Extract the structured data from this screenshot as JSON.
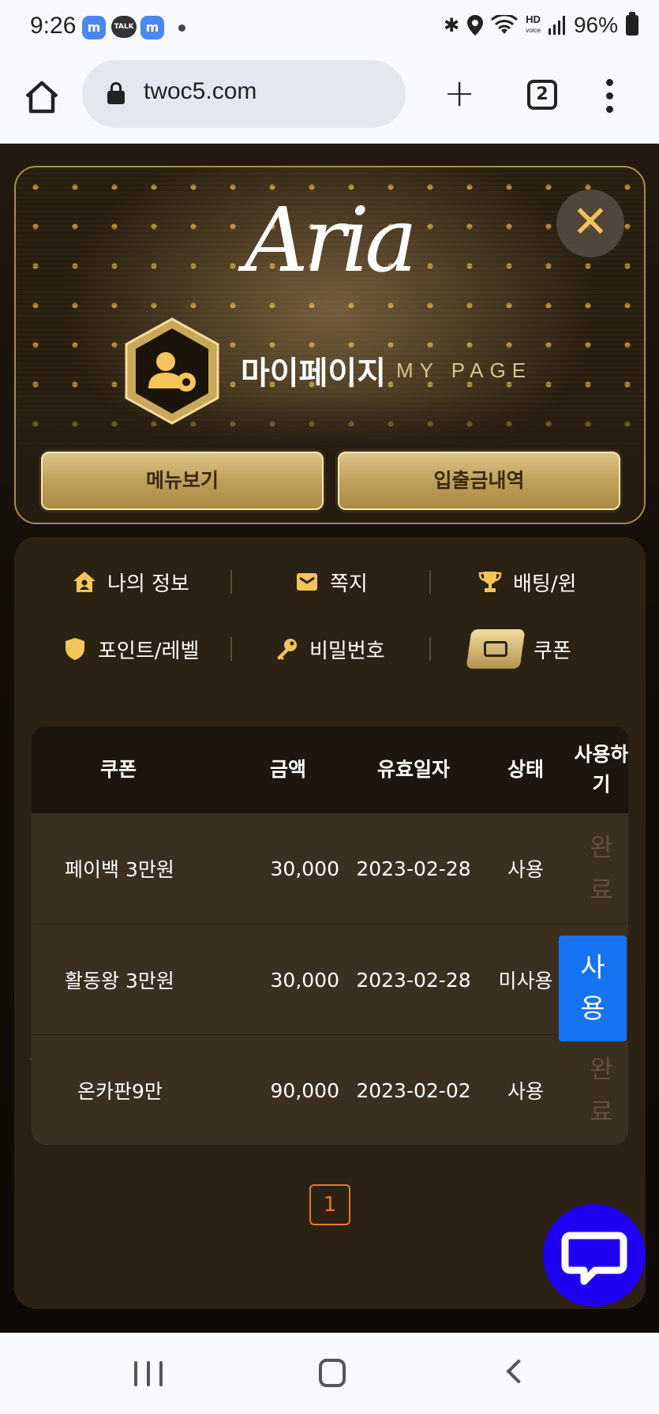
{
  "status_bar": {
    "time": "9:26",
    "battery": "96%",
    "hd_label": "HD",
    "hd_sub": "voice",
    "talk_label": "TALK",
    "icons": [
      "messenger-icon",
      "talk-icon",
      "messenger-icon",
      "notification-dot",
      "bluetooth-icon",
      "location-icon",
      "wifi-icon",
      "hd-voice-icon",
      "signal-icon",
      "battery-icon"
    ]
  },
  "browser": {
    "url": "twoc5.com",
    "tab_count": "2"
  },
  "modal": {
    "logo": "Aria",
    "close_glyph": "✕",
    "title": "마이페이지",
    "subtitle": "MY PAGE",
    "buttons": {
      "menu": "메뉴보기",
      "history": "입출금내역"
    },
    "tabs": [
      {
        "label": "나의 정보",
        "icon": "house-icon"
      },
      {
        "label": "쪽지",
        "icon": "envelope-icon"
      },
      {
        "label": "배팅/윈",
        "icon": "trophy-icon"
      },
      {
        "label": "포인트/레벨",
        "icon": "shield-icon"
      },
      {
        "label": "비밀번호",
        "icon": "key-icon"
      },
      {
        "label": "쿠폰",
        "icon": "ticket-icon",
        "active": true
      }
    ],
    "table": {
      "headers": [
        "쿠폰",
        "금액",
        "유효일자",
        "상태",
        "사용하\n기"
      ],
      "rows": [
        {
          "name": "페이백 3만원",
          "amount": "30,000",
          "date": "2023-02-28",
          "status": "사용",
          "action": "완\n료",
          "action_type": "done"
        },
        {
          "name": "활동왕 3만원",
          "amount": "30,000",
          "date": "2023-02-28",
          "status": "미사용",
          "action": "사\n용",
          "action_type": "use"
        },
        {
          "name": "온카판9만",
          "amount": "90,000",
          "date": "2023-02-02",
          "status": "사용",
          "action": "완\n료",
          "action_type": "done"
        }
      ]
    },
    "pagination": {
      "current": "1"
    }
  },
  "colors": {
    "gold": "#f5c45a",
    "accent_blue": "#1673f2",
    "pager_orange": "#e8772c",
    "chat_blue": "#1f00f0"
  }
}
